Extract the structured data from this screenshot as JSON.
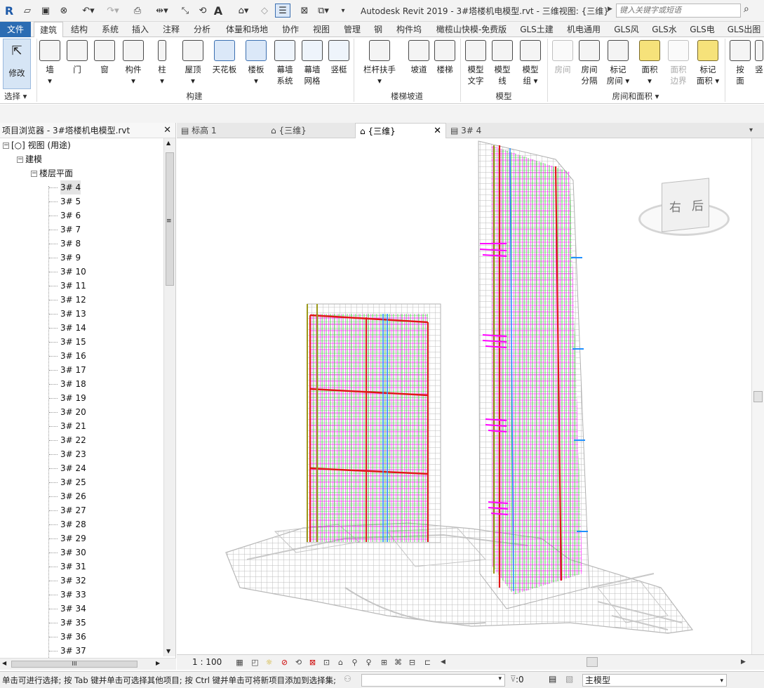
{
  "titlebar": {
    "app_icon": "R",
    "title": "Autodesk Revit 2019 - 3#塔楼机电模型.rvt - 三维视图: {三维}",
    "search_placeholder": "键入关键字或短语"
  },
  "tabs": [
    "文件",
    "建筑",
    "结构",
    "系统",
    "插入",
    "注释",
    "分析",
    "体量和场地",
    "协作",
    "视图",
    "管理",
    "钢",
    "构件坞",
    "橄榄山快模-免费版",
    "GLS土建",
    "机电通用",
    "GLS风",
    "GLS水",
    "GLS电",
    "GLS出图"
  ],
  "ribbon": {
    "modify": "修改",
    "select": "选择 ▾",
    "tools": [
      {
        "label": "墙",
        "sub": "▾"
      },
      {
        "label": "门",
        "sub": ""
      },
      {
        "label": "窗",
        "sub": ""
      },
      {
        "label": "构件",
        "sub": "▾"
      },
      {
        "label": "柱",
        "sub": "▾"
      },
      {
        "label": "屋顶",
        "sub": "▾"
      },
      {
        "label": "天花板",
        "sub": ""
      },
      {
        "label": "楼板",
        "sub": "▾"
      },
      {
        "label": "幕墙",
        "sub": "系统"
      },
      {
        "label": "幕墙",
        "sub": "网格"
      },
      {
        "label": "竖梃",
        "sub": ""
      },
      {
        "label": "栏杆扶手",
        "sub": "▾"
      },
      {
        "label": "坡道",
        "sub": ""
      },
      {
        "label": "楼梯",
        "sub": ""
      },
      {
        "label": "模型",
        "sub": "文字"
      },
      {
        "label": "模型",
        "sub": "线"
      },
      {
        "label": "模型",
        "sub": "组 ▾"
      },
      {
        "label": "房间",
        "sub": ""
      },
      {
        "label": "房间",
        "sub": "分隔"
      },
      {
        "label": "标记",
        "sub": "房间 ▾"
      },
      {
        "label": "面积",
        "sub": "▾"
      },
      {
        "label": "面积",
        "sub": "边界"
      },
      {
        "label": "标记",
        "sub": "面积 ▾"
      },
      {
        "label": "按",
        "sub": "面"
      },
      {
        "label": "竖",
        "sub": ""
      }
    ],
    "panels": [
      "构建",
      "楼梯坡道",
      "模型",
      "房间和面积 ▾"
    ]
  },
  "browser": {
    "title": "项目浏览器 - 3#塔楼机电模型.rvt",
    "root": "视图 (用途)",
    "group": "建模",
    "subgroup": "楼层平面",
    "items": [
      "3# 4",
      "3# 5",
      "3# 6",
      "3# 7",
      "3# 8",
      "3# 9",
      "3# 10",
      "3# 11",
      "3# 12",
      "3# 13",
      "3# 14",
      "3# 15",
      "3# 16",
      "3# 17",
      "3# 18",
      "3# 19",
      "3# 20",
      "3# 21",
      "3# 22",
      "3# 23",
      "3# 24",
      "3# 25",
      "3# 26",
      "3# 27",
      "3# 28",
      "3# 29",
      "3# 30",
      "3# 31",
      "3# 32",
      "3# 33",
      "3# 34",
      "3# 35",
      "3# 36",
      "3# 37"
    ],
    "hscroll_label": "III"
  },
  "view_tabs": [
    "标高 1",
    "{三维}",
    "{三维}",
    "3# 4"
  ],
  "viewcube": {
    "right": "右",
    "back": "后"
  },
  "viewbar": {
    "scale": "1 : 100"
  },
  "status": {
    "text": "单击可进行选择; 按 Tab 键并单击可选择其他项目; 按 Ctrl 键并单击可将新项目添加到选择集;",
    "zero": ":0",
    "model": "主模型"
  },
  "colors": {
    "file_tab": "#2b6cb3",
    "pipe_magenta": "#ff00ff",
    "pipe_green": "#3ccf3c",
    "pipe_red": "#e01818",
    "pipe_olive": "#9c9a1a",
    "pipe_blue": "#1e8fff"
  }
}
